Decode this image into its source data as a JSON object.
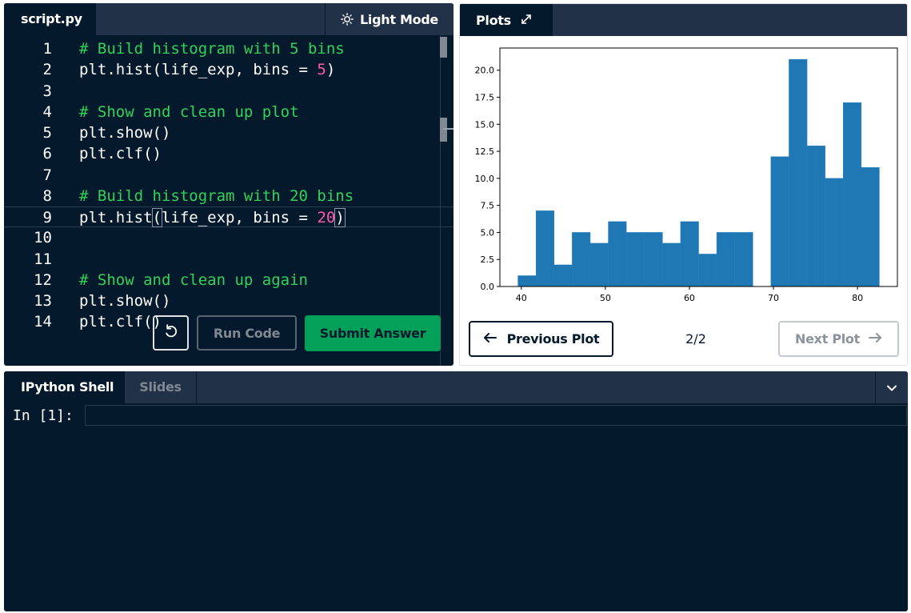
{
  "editor": {
    "tab_label": "script.py",
    "light_mode_label": "Light Mode",
    "lines": [
      {
        "n": "1",
        "segments": [
          {
            "t": "# Build histogram with 5 bins",
            "c": "cmt"
          }
        ]
      },
      {
        "n": "2",
        "segments": [
          {
            "t": "plt.hist(life_exp, bins = ",
            "c": ""
          },
          {
            "t": "5",
            "c": "num"
          },
          {
            "t": ")",
            "c": ""
          }
        ]
      },
      {
        "n": "3",
        "segments": []
      },
      {
        "n": "4",
        "segments": [
          {
            "t": "# Show and clean up plot",
            "c": "cmt"
          }
        ]
      },
      {
        "n": "5",
        "segments": [
          {
            "t": "plt.show()",
            "c": ""
          }
        ]
      },
      {
        "n": "6",
        "segments": [
          {
            "t": "plt.clf()",
            "c": ""
          }
        ]
      },
      {
        "n": "7",
        "segments": []
      },
      {
        "n": "8",
        "segments": [
          {
            "t": "# Build histogram with 20 bins",
            "c": "cmt"
          }
        ]
      },
      {
        "n": "9",
        "segments": [
          {
            "t": "plt.hist",
            "c": ""
          },
          {
            "t": "(",
            "c": "bracket"
          },
          {
            "t": "life_exp, bins = ",
            "c": ""
          },
          {
            "t": "20",
            "c": "num"
          },
          {
            "t": ")",
            "c": "bracket"
          }
        ],
        "active": true
      },
      {
        "n": "10",
        "segments": []
      },
      {
        "n": "11",
        "segments": []
      },
      {
        "n": "12",
        "segments": [
          {
            "t": "# Show and clean up again",
            "c": "cmt"
          }
        ]
      },
      {
        "n": "13",
        "segments": [
          {
            "t": "plt.show()",
            "c": ""
          }
        ]
      },
      {
        "n": "14",
        "segments": [
          {
            "t": "plt.clf()",
            "c": ""
          }
        ]
      }
    ],
    "run_label": "Run Code",
    "submit_label": "Submit Answer",
    "reset_icon": "reset-icon"
  },
  "plots": {
    "tab_label": "Plots",
    "expand_icon": "expand-icon",
    "prev_label": "Previous Plot",
    "next_label": "Next Plot",
    "page": "2/2"
  },
  "shell": {
    "tab_ipython": "IPython Shell",
    "tab_slides": "Slides",
    "prompt": "In [1]:",
    "input_value": ""
  },
  "colors": {
    "editor_bg": "#05192d",
    "tab_bar": "#213147",
    "comment": "#2fd35a",
    "number": "#ff5aa8",
    "submit": "#03a05a",
    "bar": "#1f77b4"
  },
  "chart_data": {
    "type": "bar",
    "title": "",
    "xlabel": "",
    "ylabel": "",
    "bin_edges": [
      39.6,
      41.75,
      43.9,
      46.05,
      48.2,
      50.35,
      52.5,
      54.65,
      56.8,
      58.95,
      61.1,
      63.25,
      65.4,
      67.55,
      69.7,
      71.85,
      74.0,
      76.15,
      78.3,
      80.45,
      82.6
    ],
    "values": [
      1,
      7,
      2,
      5,
      4,
      6,
      5,
      5,
      4,
      6,
      3,
      5,
      5,
      0,
      12,
      21,
      13,
      10,
      17,
      11
    ],
    "xlim": [
      37.45,
      84.75
    ],
    "ylim": [
      0,
      22.05
    ],
    "x_ticks": [
      40,
      50,
      60,
      70,
      80
    ],
    "y_ticks": [
      0.0,
      2.5,
      5.0,
      7.5,
      10.0,
      12.5,
      15.0,
      17.5,
      20.0
    ],
    "x_tick_labels": [
      "40",
      "50",
      "60",
      "70",
      "80"
    ],
    "y_tick_labels": [
      "0.0",
      "2.5",
      "5.0",
      "7.5",
      "10.0",
      "12.5",
      "15.0",
      "17.5",
      "20.0"
    ],
    "grid": false
  }
}
